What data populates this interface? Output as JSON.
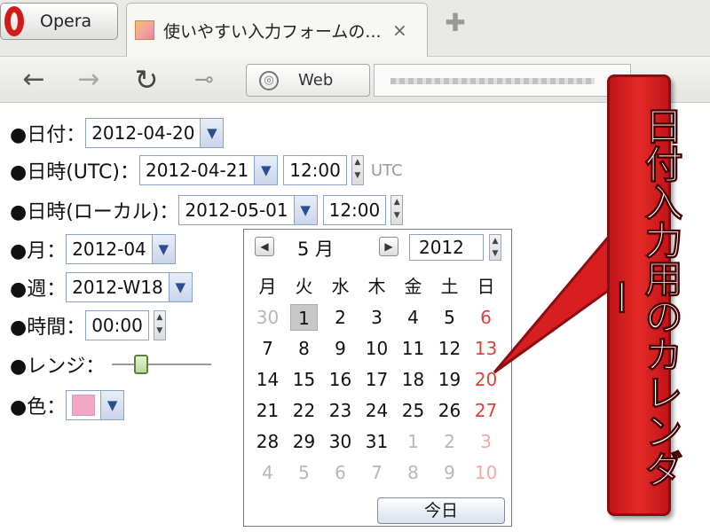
{
  "browser": {
    "menu_label": "Opera",
    "tab_title": "使いやすい入力フォームの...",
    "tab_close": "×",
    "newtab": "✚",
    "search_engine": "Web"
  },
  "nav": {
    "back": "←",
    "forward": "→",
    "reload": "↻",
    "key": "⊸"
  },
  "form": {
    "date": {
      "label": "●日付：",
      "value": "2012-04-20"
    },
    "datetime_utc": {
      "label": "●日時(UTC)：",
      "date": "2012-04-21",
      "time": "12:00",
      "tz": "UTC"
    },
    "datetime_local": {
      "label": "●日時(ローカル)：",
      "date": "2012-05-01",
      "time": "12:00"
    },
    "month": {
      "label": "●月：",
      "value": "2012-04"
    },
    "week": {
      "label": "●週：",
      "value": "2012-W18"
    },
    "time": {
      "label": "●時間：",
      "value": "00:00"
    },
    "range": {
      "label": "●レンジ：",
      "level": 0.25
    },
    "color": {
      "label": "●色：",
      "value": "#f4a6c6"
    }
  },
  "calendar": {
    "prev": "◀",
    "month": "5 月",
    "next": "▶",
    "year": "2012",
    "weekdays": [
      "月",
      "火",
      "水",
      "木",
      "金",
      "土",
      "日"
    ],
    "days": [
      "30",
      "1",
      "2",
      "3",
      "4",
      "5",
      "6",
      "7",
      "8",
      "9",
      "10",
      "11",
      "12",
      "13",
      "14",
      "15",
      "16",
      "17",
      "18",
      "19",
      "20",
      "21",
      "22",
      "23",
      "24",
      "25",
      "26",
      "27",
      "28",
      "29",
      "30",
      "31",
      "1",
      "2",
      "3",
      "4",
      "5",
      "6",
      "7",
      "8",
      "9",
      "10"
    ],
    "selected_day": "1",
    "today_button": "今日"
  },
  "annotation": {
    "text": "日付入力用のカレンダー",
    "color": "#e42a27"
  },
  "icons": {
    "opera": "opera-logo-icon",
    "back": "back-arrow-icon",
    "forward": "forward-arrow-icon",
    "reload": "reload-icon",
    "key": "key-icon",
    "globe": "globe-icon",
    "close": "close-icon",
    "dropdown": "chevron-down-icon",
    "spinner": "spinner-arrows-icon"
  }
}
